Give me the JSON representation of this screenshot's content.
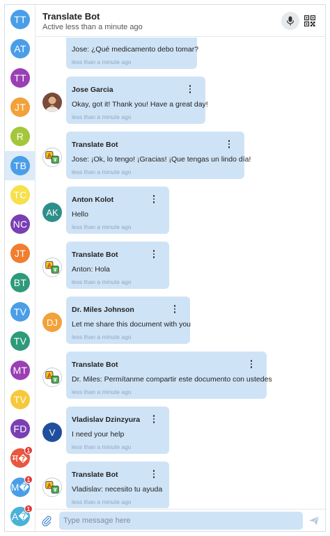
{
  "header": {
    "title": "Translate Bot",
    "status": "Active less than a minute ago",
    "mic_icon": "microphone-icon",
    "qr_icon": "qr-code-icon"
  },
  "sidebar": {
    "items": [
      {
        "initials": "TT",
        "color": "#4a9ee8",
        "active": false,
        "badge": ""
      },
      {
        "initials": "AT",
        "color": "#4a9ee8",
        "active": false,
        "badge": ""
      },
      {
        "initials": "TT",
        "color": "#9b3fb5",
        "active": false,
        "badge": ""
      },
      {
        "initials": "JT",
        "color": "#f2a13b",
        "active": false,
        "badge": ""
      },
      {
        "initials": "R",
        "color": "#a4c63a",
        "active": false,
        "badge": ""
      },
      {
        "initials": "TB",
        "color": "#4a9ee8",
        "active": true,
        "badge": ""
      },
      {
        "initials": "TC",
        "color": "#f7e04a",
        "active": false,
        "badge": ""
      },
      {
        "initials": "NC",
        "color": "#7a3fb5",
        "active": false,
        "badge": ""
      },
      {
        "initials": "JT",
        "color": "#f07e2f",
        "active": false,
        "badge": ""
      },
      {
        "initials": "BT",
        "color": "#2e9a7a",
        "active": false,
        "badge": ""
      },
      {
        "initials": "TV",
        "color": "#4a9ee8",
        "active": false,
        "badge": ""
      },
      {
        "initials": "TV",
        "color": "#2e9a7a",
        "active": false,
        "badge": ""
      },
      {
        "initials": "MT",
        "color": "#9b3fb5",
        "active": false,
        "badge": ""
      },
      {
        "initials": "TV",
        "color": "#f7c93a",
        "active": false,
        "badge": ""
      },
      {
        "initials": "FD",
        "color": "#7a3fb5",
        "active": false,
        "badge": ""
      },
      {
        "initials": "म�",
        "color": "#e8573f",
        "active": false,
        "badge": "1"
      },
      {
        "initials": "M�",
        "color": "#4a9ee8",
        "active": false,
        "badge": "1"
      },
      {
        "initials": "A�",
        "color": "#4ab2d8",
        "active": false,
        "badge": "1"
      }
    ]
  },
  "messages": [
    {
      "sender": "",
      "text": "Jose: ¿Qué medicamento debo tomar?",
      "time": "less than a minute ago",
      "avatar_type": "none",
      "avatar_initials": "",
      "avatar_color": "",
      "width": 188
    },
    {
      "sender": "Jose Garcia",
      "text": "Okay, got it! Thank you! Have a great day!",
      "time": "less than a minute ago",
      "avatar_type": "photo",
      "avatar_initials": "",
      "avatar_color": "#a0523a",
      "width": 200
    },
    {
      "sender": "Translate Bot",
      "text": "Jose: ¡Ok, lo tengo! ¡Gracias! ¡Que tengas un lindo día!",
      "time": "less than a minute ago",
      "avatar_type": "bot",
      "avatar_initials": "",
      "avatar_color": "",
      "width": 256
    },
    {
      "sender": "Anton Kolot",
      "text": "Hello",
      "time": "less than a minute ago",
      "avatar_type": "initials",
      "avatar_initials": "AK",
      "avatar_color": "#2e8f8a",
      "width": 148
    },
    {
      "sender": "Translate Bot",
      "text": "Anton: Hola",
      "time": "less than a minute ago",
      "avatar_type": "bot",
      "avatar_initials": "",
      "avatar_color": "",
      "width": 148
    },
    {
      "sender": "Dr. Miles Johnson",
      "text": "Let me share this document with you",
      "time": "less than a minute ago",
      "avatar_type": "initials",
      "avatar_initials": "DJ",
      "avatar_color": "#f2a13b",
      "width": 178
    },
    {
      "sender": "Translate Bot",
      "text": "Dr. Miles: Permítanme compartir este documento con ustedes",
      "time": "less than a minute ago",
      "avatar_type": "bot",
      "avatar_initials": "",
      "avatar_color": "",
      "width": 288
    },
    {
      "sender": "Vladislav Dzinzyura",
      "text": "I need your help",
      "time": "less than a minute ago",
      "avatar_type": "initials",
      "avatar_initials": "V",
      "avatar_color": "#1f4f9c",
      "width": 148
    },
    {
      "sender": "Translate Bot",
      "text": "Vladislav: necesito tu ayuda",
      "time": "less than a minute ago",
      "avatar_type": "bot",
      "avatar_initials": "",
      "avatar_color": "",
      "width": 148
    }
  ],
  "composer": {
    "placeholder": "Type message here",
    "attach_icon": "paperclip-icon",
    "send_icon": "send-icon"
  }
}
